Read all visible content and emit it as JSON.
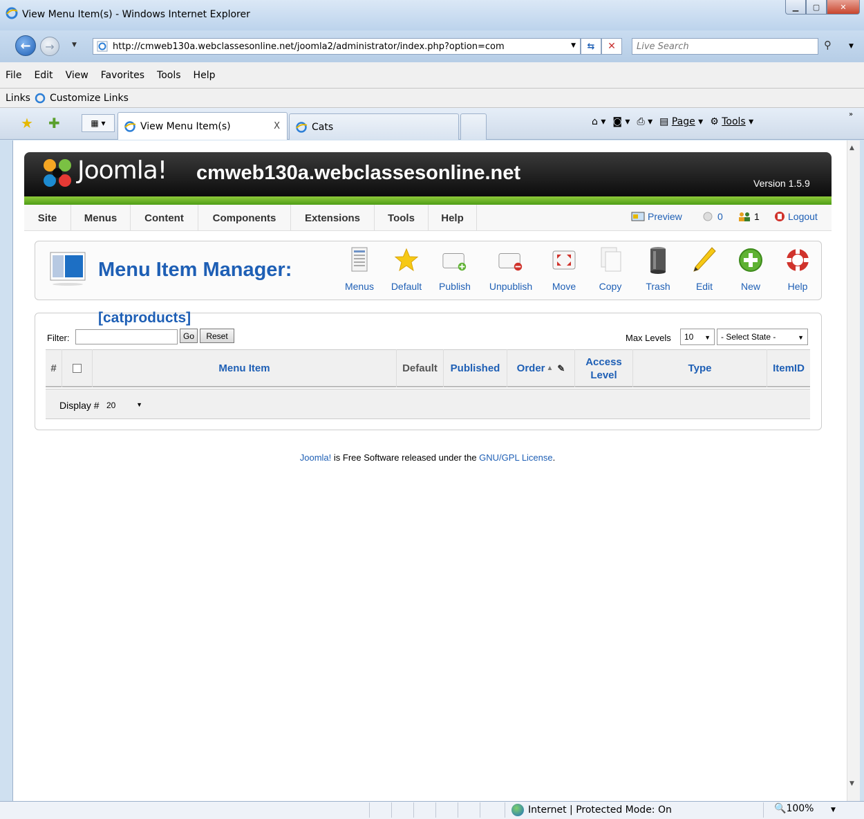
{
  "window": {
    "title": "View Menu Item(s) - Windows Internet Explorer",
    "address": "http://cmweb130a.webclassesonline.net/joomla2/administrator/index.php?option=com",
    "search_placeholder": "Live Search"
  },
  "menubar": [
    "File",
    "Edit",
    "View",
    "Favorites",
    "Tools",
    "Help"
  ],
  "linksbar": {
    "label": "Links",
    "item": "Customize Links"
  },
  "tabs": [
    {
      "label": "View Menu Item(s)",
      "active": true,
      "close": "X"
    },
    {
      "label": "Cats",
      "active": false
    }
  ],
  "commandbar": {
    "page": "Page",
    "tools": "Tools"
  },
  "joomla": {
    "logo_text": "Joomla!",
    "site_name": "cmweb130a.webclassesonline.net",
    "version": "Version 1.5.9",
    "nav": [
      "Site",
      "Menus",
      "Content",
      "Components",
      "Extensions",
      "Tools",
      "Help"
    ],
    "status": {
      "preview": "Preview",
      "messages": "0",
      "users": "1",
      "logout": "Logout"
    },
    "manager_title": "Menu Item Manager:",
    "toolbar": [
      "Menus",
      "Default",
      "Publish",
      "Unpublish",
      "Move",
      "Copy",
      "Trash",
      "Edit",
      "New",
      "Help"
    ],
    "menu_name": "[catproducts]",
    "filter": {
      "label": "Filter:",
      "value": "",
      "go": "Go",
      "reset": "Reset"
    },
    "max_levels": {
      "label": "Max Levels",
      "value": "10"
    },
    "state_select": "- Select State -",
    "columns": [
      "#",
      "Menu Item",
      "Default",
      "Published",
      "Order",
      "Access Level",
      "Type",
      "ItemID"
    ],
    "display": {
      "label": "Display #",
      "value": "20"
    },
    "footer": {
      "link1": "Joomla!",
      "middle": " is Free Software released under the ",
      "link2": "GNU/GPL License",
      "end": "."
    }
  },
  "statusbar": {
    "zone": "Internet | Protected Mode: On",
    "zoom": "100%"
  },
  "colors": {
    "joomla_blue": "#1e5fb5",
    "joomla_green": "#6cb42a",
    "header_black": "#0c0c0c"
  }
}
